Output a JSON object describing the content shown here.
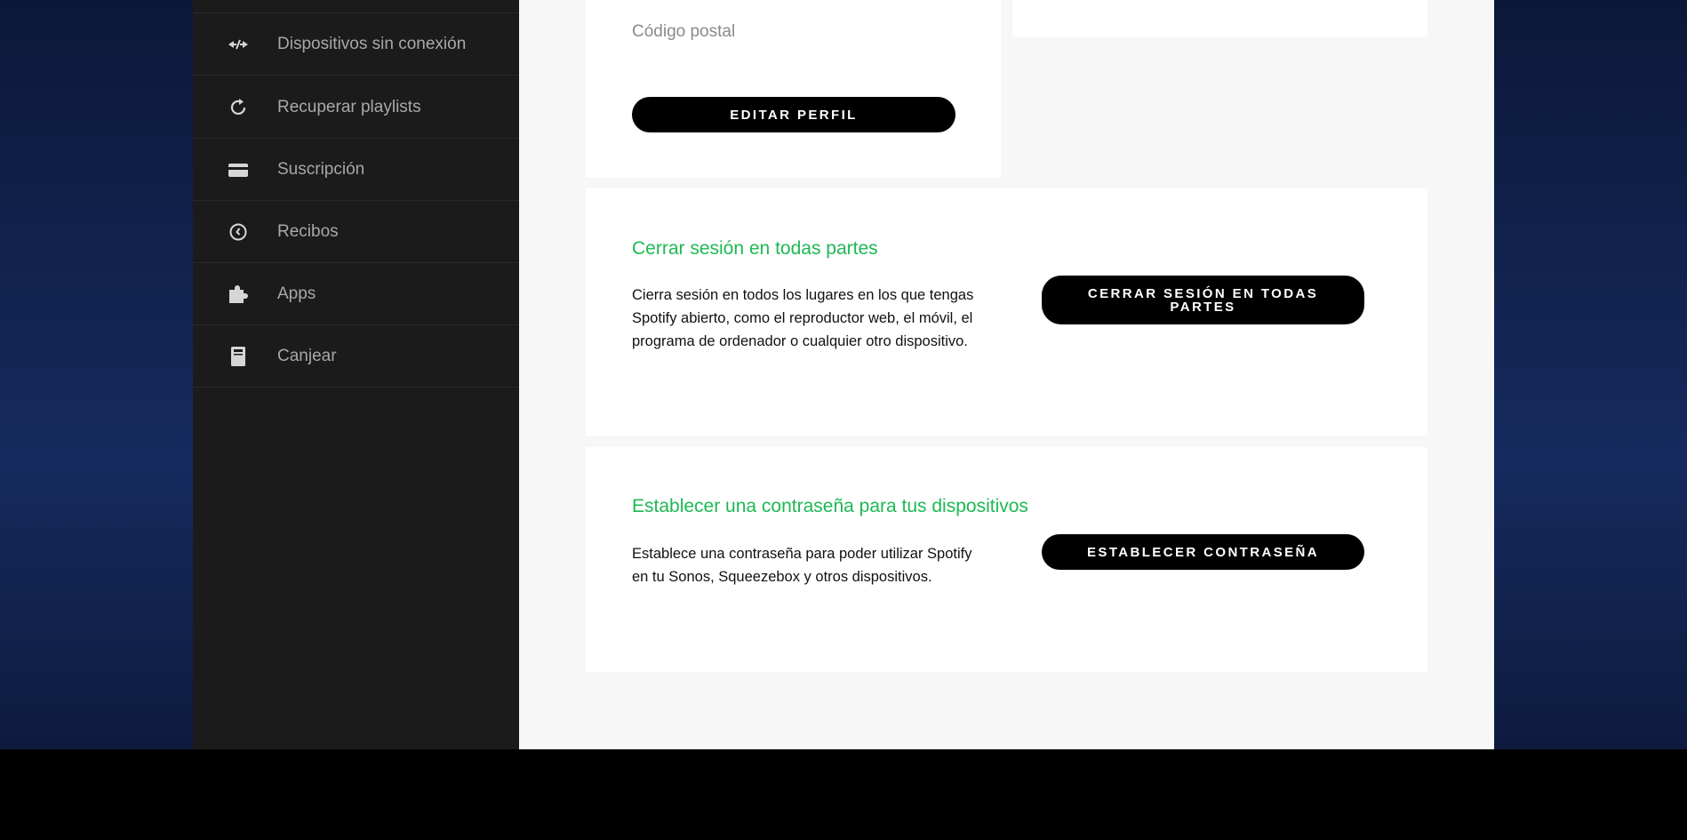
{
  "sidebar": {
    "items": [
      {
        "label": "Dispositivos sin conexión",
        "icon": "offline-devices-icon"
      },
      {
        "label": "Recuperar playlists",
        "icon": "refresh-icon"
      },
      {
        "label": "Suscripción",
        "icon": "credit-card-icon"
      },
      {
        "label": "Recibos",
        "icon": "clock-icon"
      },
      {
        "label": "Apps",
        "icon": "puzzle-icon"
      },
      {
        "label": "Canjear",
        "icon": "gift-card-icon"
      }
    ]
  },
  "profile": {
    "postal_code_label": "Código postal",
    "edit_button": "EDITAR PERFIL"
  },
  "logout_everywhere": {
    "title": "Cerrar sesión en todas partes",
    "description": "Cierra sesión en todos los lugares en los que tengas Spotify abierto, como el reproductor web, el móvil, el programa de ordenador o cualquier otro dispositivo.",
    "button": "CERRAR SESIÓN EN TODAS PARTES"
  },
  "device_password": {
    "title": "Establecer una contraseña para tus dispositivos",
    "description": "Establece una contraseña para poder utilizar Spotify en tu Sonos, Squeezebox y otros dispositivos.",
    "button": "ESTABLECER CONTRASEÑA"
  },
  "colors": {
    "accent_green": "#1db954",
    "sidebar_bg": "#1b1b1b",
    "button_bg": "#000000"
  }
}
